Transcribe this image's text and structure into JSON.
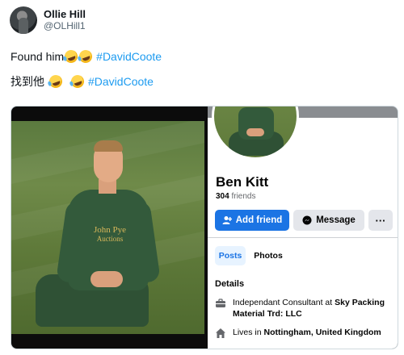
{
  "tweet": {
    "author_name": "Ollie Hill",
    "author_handle": "@OLHill1",
    "line1_text": "Found him",
    "line1_hashtag": "#DavidCoote",
    "line2_text": "找到他",
    "line2_hashtag": "#DavidCoote"
  },
  "photo": {
    "sponsor_line1": "John Pye",
    "sponsor_line2": "Auctions"
  },
  "profile": {
    "name": "Ben Kitt",
    "friends_count": "304",
    "friends_label": "friends",
    "add_friend_label": "Add friend",
    "message_label": "Message",
    "more_label": "···",
    "tabs": [
      {
        "label": "Posts"
      },
      {
        "label": "Photos"
      }
    ],
    "details_title": "Details",
    "work_prefix": "Independant Consultant at ",
    "work_company": "Sky Packing Material Trd: LLC",
    "lives_prefix": "Lives in ",
    "lives_place": "Nottingham, United Kingdom"
  },
  "colors": {
    "facebook_blue": "#1b74e4",
    "twitter_link": "#1d9bf0"
  }
}
